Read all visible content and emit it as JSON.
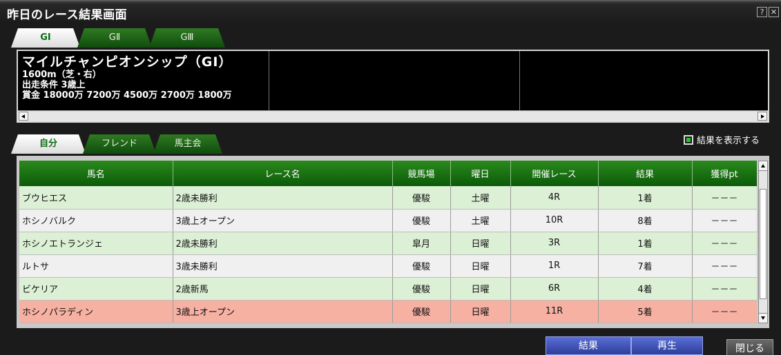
{
  "window": {
    "title": "昨日のレース結果画面",
    "help_label": "?",
    "close_label": "✕"
  },
  "grade_tabs": [
    {
      "label": "GⅠ",
      "active": true
    },
    {
      "label": "GⅡ",
      "active": false
    },
    {
      "label": "GⅢ",
      "active": false
    }
  ],
  "race": {
    "name": "マイルチャンピオンシップ（GⅠ）",
    "distance": "1600m（芝・右）",
    "condition": "出走条件 3歳上",
    "prize": "賞金  18000万 7200万 4500万 2700万 1800万"
  },
  "group_tabs": [
    {
      "label": "自分",
      "active": true
    },
    {
      "label": "フレンド",
      "active": false
    },
    {
      "label": "馬主会",
      "active": false
    }
  ],
  "show_results": {
    "label": "結果を表示する",
    "checked": true
  },
  "table": {
    "columns": [
      "馬名",
      "レース名",
      "競馬場",
      "曜日",
      "開催レース",
      "結果",
      "獲得pt"
    ],
    "rows": [
      {
        "horse": "ブウヒエス",
        "race": "2歳未勝利",
        "course": "優駿",
        "day": "土曜",
        "race_no": "4R",
        "result": "1着",
        "pt": "－－－",
        "style": "green"
      },
      {
        "horse": "ホシノバルク",
        "race": "3歳上オープン",
        "course": "優駿",
        "day": "土曜",
        "race_no": "10R",
        "result": "8着",
        "pt": "－－－",
        "style": "white"
      },
      {
        "horse": "ホシノエトランジェ",
        "race": "2歳未勝利",
        "course": "皐月",
        "day": "日曜",
        "race_no": "3R",
        "result": "1着",
        "pt": "－－－",
        "style": "green"
      },
      {
        "horse": "ルトサ",
        "race": "3歳未勝利",
        "course": "優駿",
        "day": "日曜",
        "race_no": "1R",
        "result": "7着",
        "pt": "－－－",
        "style": "white"
      },
      {
        "horse": "ビケリア",
        "race": "2歳新馬",
        "course": "優駿",
        "day": "日曜",
        "race_no": "6R",
        "result": "4着",
        "pt": "－－－",
        "style": "green"
      },
      {
        "horse": "ホシノパラディン",
        "race": "3歳上オープン",
        "course": "優駿",
        "day": "日曜",
        "race_no": "11R",
        "result": "5着",
        "pt": "－－－",
        "style": "pink"
      }
    ]
  },
  "buttons": {
    "result": "結果",
    "replay": "再生",
    "close": "閉じる"
  }
}
